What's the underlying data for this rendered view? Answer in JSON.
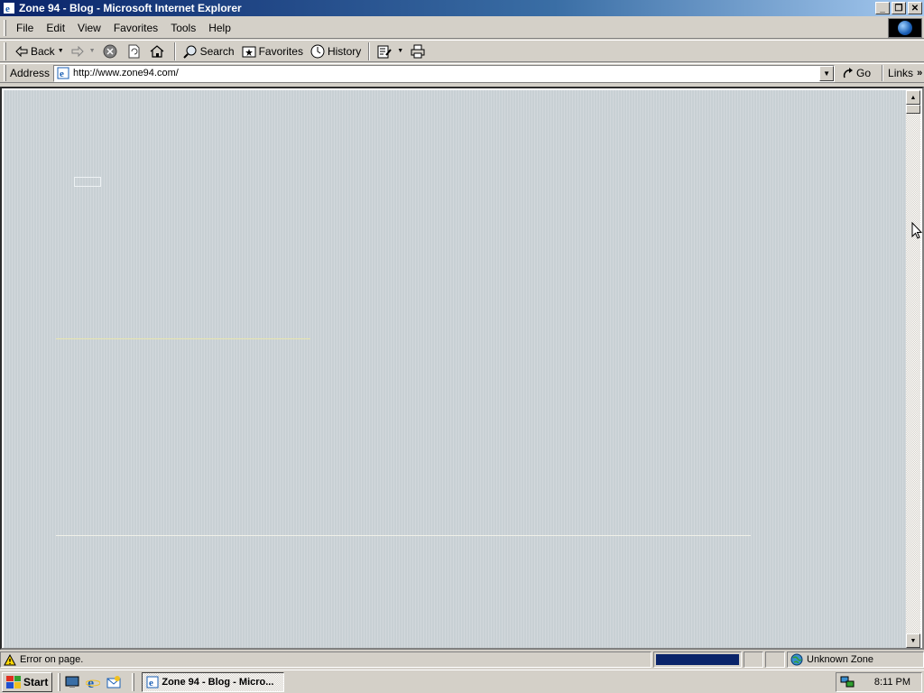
{
  "window": {
    "title": "Zone 94 - Blog - Microsoft Internet Explorer",
    "controls": {
      "minimize": "_",
      "maximize": "❐",
      "close": "✕"
    }
  },
  "menu": {
    "items": [
      "File",
      "Edit",
      "View",
      "Favorites",
      "Tools",
      "Help"
    ]
  },
  "toolbar": {
    "back_label": "Back",
    "search_label": "Search",
    "favorites_label": "Favorites",
    "history_label": "History",
    "icons": [
      "back-icon",
      "forward-icon",
      "stop-icon",
      "refresh-icon",
      "home-icon",
      "search-icon",
      "favorites-icon",
      "history-icon",
      "edit-icon",
      "print-icon"
    ]
  },
  "address": {
    "label": "Address",
    "url": "http://www.zone94.com/",
    "go_label": "Go",
    "links_label": "Links",
    "chevron": "»"
  },
  "content": {
    "background": "#c8d0d4"
  },
  "status": {
    "message": "Error on page.",
    "zone": "Unknown Zone",
    "progress": 1.0
  },
  "taskbar": {
    "start_label": "Start",
    "task_label": "Zone 94 - Blog - Micro...",
    "clock": "8:11 PM"
  }
}
